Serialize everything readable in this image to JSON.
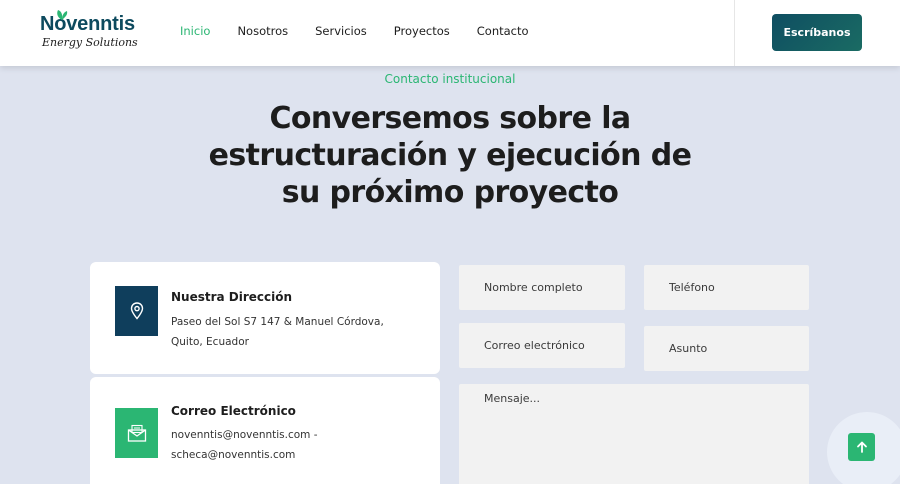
{
  "header": {
    "logo": {
      "brand": "Novenntis",
      "tagline": "Energy Solutions",
      "brand_color": "#0d4a5e",
      "leaf_color": "#2bb673"
    },
    "nav": [
      {
        "label": "Inicio",
        "active": true
      },
      {
        "label": "Nosotros",
        "active": false
      },
      {
        "label": "Servicios",
        "active": false
      },
      {
        "label": "Proyectos",
        "active": false
      },
      {
        "label": "Contacto",
        "active": false
      }
    ],
    "cta_label": "Escríbanos"
  },
  "hero": {
    "eyebrow": "Contacto institucional",
    "title": "Conversemos sobre la estructuración y ejecución de su próximo proyecto"
  },
  "contact_cards": [
    {
      "icon": "location-pin-icon",
      "title": "Nuestra Dirección",
      "text": "Paseo del Sol S7 147 & Manuel Córdova, Quito, Ecuador"
    },
    {
      "icon": "email-envelope-icon",
      "title": "Correo Electrónico",
      "text": "novenntis@novenntis.com - scheca@novenntis.com"
    }
  ],
  "form": {
    "name_placeholder": "Nombre completo",
    "phone_placeholder": "Teléfono",
    "email_placeholder": "Correo electrónico",
    "subject_placeholder": "Asunto",
    "message_placeholder": "Mensaje..."
  },
  "colors": {
    "accent": "#2bb673",
    "dark": "#0f3e5c",
    "background": "#dee3ef"
  },
  "scroll_top_icon": "arrow-up-icon"
}
